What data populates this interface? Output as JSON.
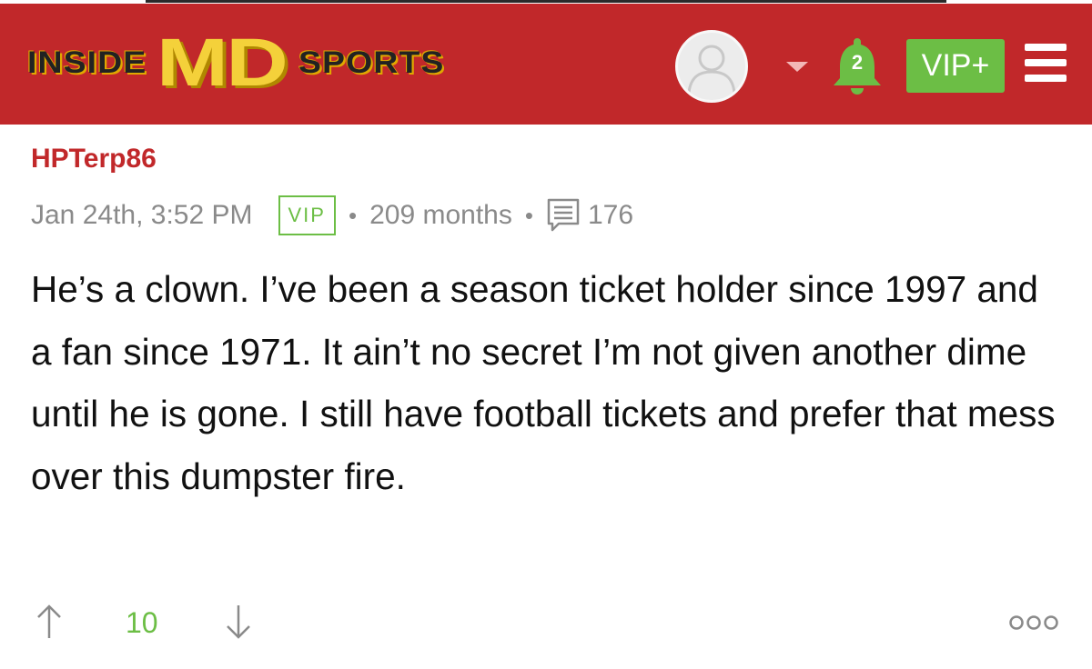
{
  "header": {
    "logo": {
      "inside": "INSIDE",
      "md": "MD",
      "sports": "SPORTS"
    },
    "notifications": {
      "count": "2",
      "icon": "bell-icon"
    },
    "vip_button": "VIP+",
    "colors": {
      "header_bg": "#c1282a",
      "accent_green": "#6cbe45",
      "logo_yellow": "#f4d13a"
    }
  },
  "post": {
    "author": "HPTerp86",
    "timestamp": "Jan 24th, 3:52 PM",
    "badge": "VIP",
    "membership": "209 months",
    "post_count": "176",
    "body": "He’s a clown. I’ve been a season ticket holder since 1997 and a fan since 1971. It ain’t no secret I’m not given another dime until he is gone. I still have football tickets and prefer that mess over this dumpster fire.",
    "score": "10"
  }
}
